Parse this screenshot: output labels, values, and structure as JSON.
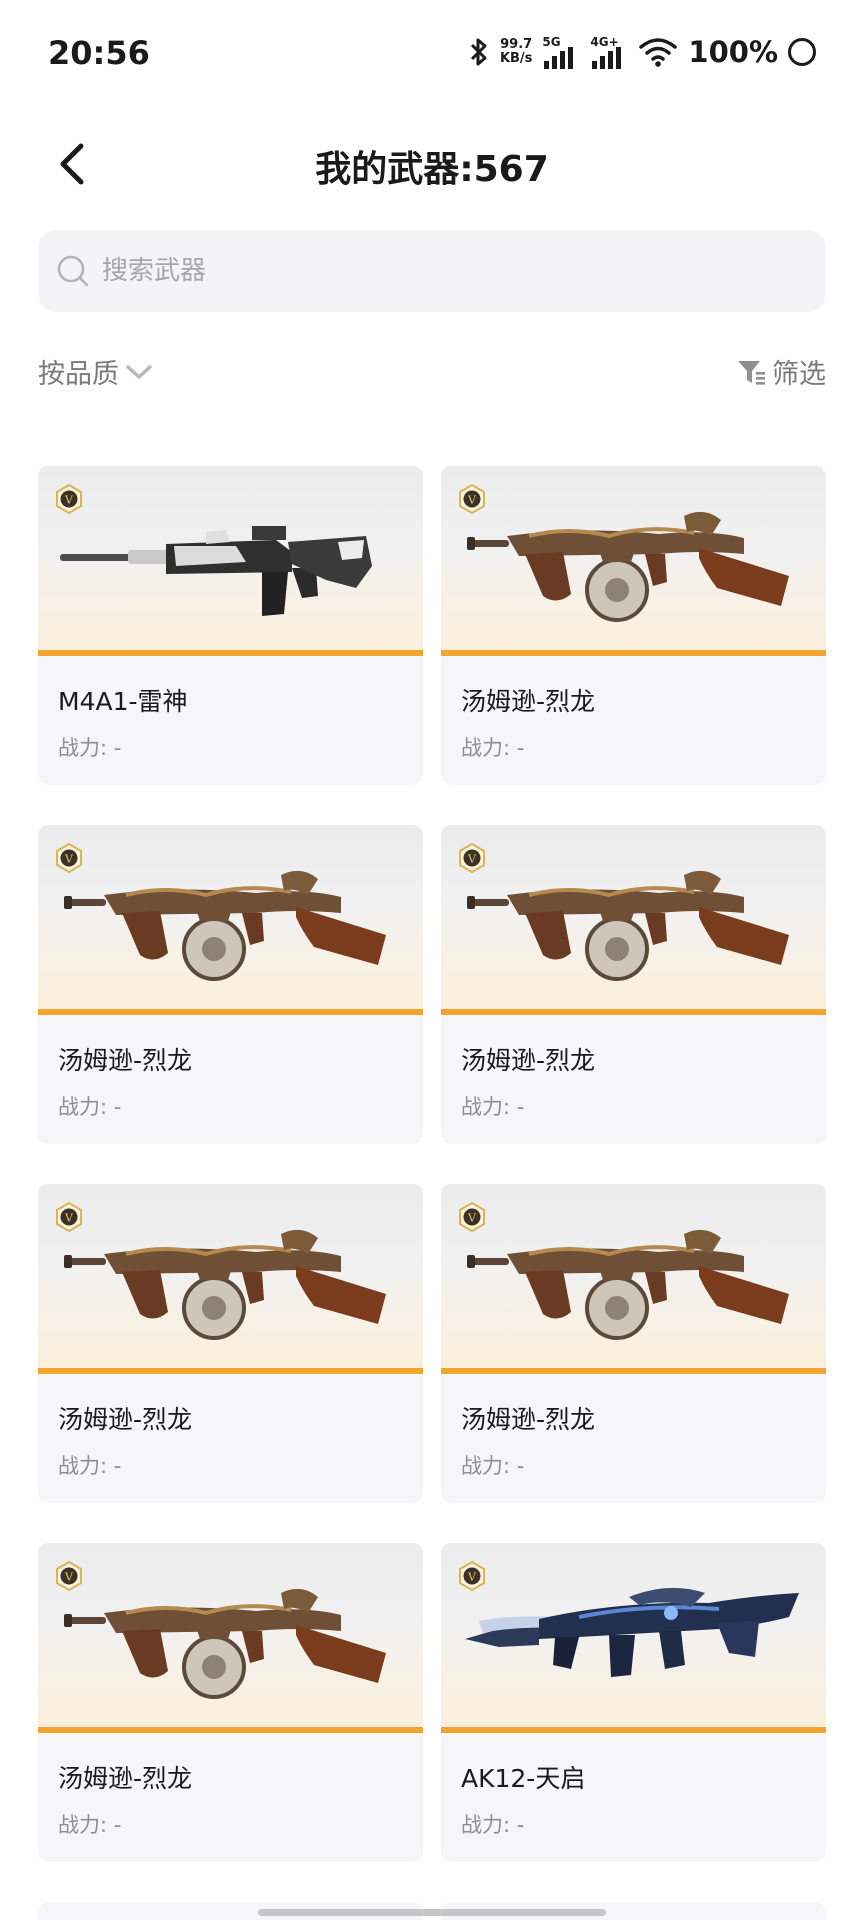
{
  "status_bar": {
    "time": "20:56",
    "net_speed_value": "99.7",
    "net_speed_unit": "KB/s",
    "sim1_label": "5G",
    "sim2_label": "4G+",
    "battery": "100%"
  },
  "header": {
    "title": "我的武器:567"
  },
  "search": {
    "placeholder": "搜索武器"
  },
  "filters": {
    "sort_label": "按品质",
    "filter_label": "筛选"
  },
  "weapons": [
    {
      "name": "M4A1-雷神",
      "power": "战力: -",
      "gun_icon": "rifle-m4a1-icon"
    },
    {
      "name": "汤姆逊-烈龙",
      "power": "战力: -",
      "gun_icon": "smg-thompson-icon"
    },
    {
      "name": "汤姆逊-烈龙",
      "power": "战力: -",
      "gun_icon": "smg-thompson-icon"
    },
    {
      "name": "汤姆逊-烈龙",
      "power": "战力: -",
      "gun_icon": "smg-thompson-icon"
    },
    {
      "name": "汤姆逊-烈龙",
      "power": "战力: -",
      "gun_icon": "smg-thompson-icon"
    },
    {
      "name": "汤姆逊-烈龙",
      "power": "战力: -",
      "gun_icon": "smg-thompson-icon"
    },
    {
      "name": "汤姆逊-烈龙",
      "power": "战力: -",
      "gun_icon": "smg-thompson-icon"
    },
    {
      "name": "AK12-天启",
      "power": "战力: -",
      "gun_icon": "rifle-ak12-icon"
    }
  ],
  "colors": {
    "accent_bar": "#f1a52c",
    "badge_gold": "#d8b45a",
    "card_bg": "#f6f6f8"
  }
}
